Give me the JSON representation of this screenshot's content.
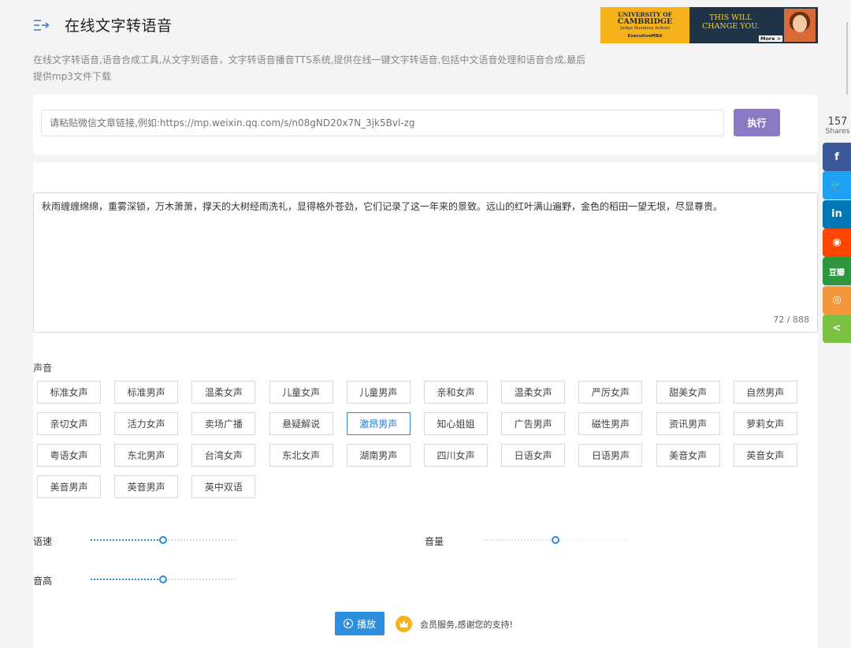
{
  "header": {
    "title": "在线文字转语音",
    "menu_icon": "menu-arrow-icon"
  },
  "ad": {
    "univ_line1": "UNIVERSITY OF",
    "univ_line2": "CAMBRIDGE",
    "univ_line3": "Judge Business School",
    "univ_line4": "ExecutiveMBA",
    "tagline_1": "THIS WILL",
    "tagline_2": "CHANGE YOU.",
    "more": "More >"
  },
  "description": "在线文字转语音,语音合成工具,从文字到语音，文字转语音播音TTS系统,提供在线一键文字转语音,包括中文语音处理和语音合成,最后提供mp3文件下载",
  "url_form": {
    "placeholder": "请粘贴微信文章链接,例如:https://mp.weixin.qq.com/s/n08gND20x7N_3jk5Bvl-zg",
    "value": "",
    "execute_label": "执行"
  },
  "editor": {
    "text": "秋雨缠缠绵绵，重雾深锁，万木萧萧，撑天的大树经雨洗礼，显得格外苍劲，它们记录了这一年来的景致。远山的红叶满山遍野，金色的稻田一望无垠，尽显尊贵。",
    "counter": "72 / 888"
  },
  "voices": {
    "label": "声音",
    "selected": "激昂男声",
    "items": [
      "标准女声",
      "标准男声",
      "温柔女声",
      "儿童女声",
      "儿童男声",
      "亲和女声",
      "温柔女声",
      "严厉女声",
      "甜美女声",
      "自然男声",
      "亲切女声",
      "活力女声",
      "卖场广播",
      "悬疑解说",
      "激昂男声",
      "知心姐姐",
      "广告男声",
      "磁性男声",
      "资讯男声",
      "萝莉女声",
      "粤语女声",
      "东北男声",
      "台湾女声",
      "东北女声",
      "湖南男声",
      "四川女声",
      "日语女声",
      "日语男声",
      "美音女声",
      "英音女声",
      "美音男声",
      "英音男声",
      "英中双语"
    ]
  },
  "sliders": {
    "speed": {
      "label": "语速",
      "value": 0.5
    },
    "volume": {
      "label": "音量",
      "value": 0.5
    },
    "pitch": {
      "label": "音高",
      "value": 0.5
    }
  },
  "actions": {
    "play_label": "播放",
    "member_text": "会员服务,感谢您的支持!"
  },
  "share": {
    "count": "157",
    "count_label": "Shares",
    "items": [
      {
        "name": "facebook",
        "glyph": "f",
        "color": "#3b5998"
      },
      {
        "name": "twitter",
        "glyph": "🐦",
        "color": "#1da1f2"
      },
      {
        "name": "linkedin",
        "glyph": "in",
        "color": "#0077b5"
      },
      {
        "name": "reddit",
        "glyph": "◉",
        "color": "#ff4500"
      },
      {
        "name": "douban",
        "glyph": "豆瓣",
        "color": "#2e963d"
      },
      {
        "name": "weibo",
        "glyph": "◎",
        "color": "#f3973b"
      },
      {
        "name": "share",
        "glyph": "<",
        "color": "#7bc143"
      }
    ]
  }
}
